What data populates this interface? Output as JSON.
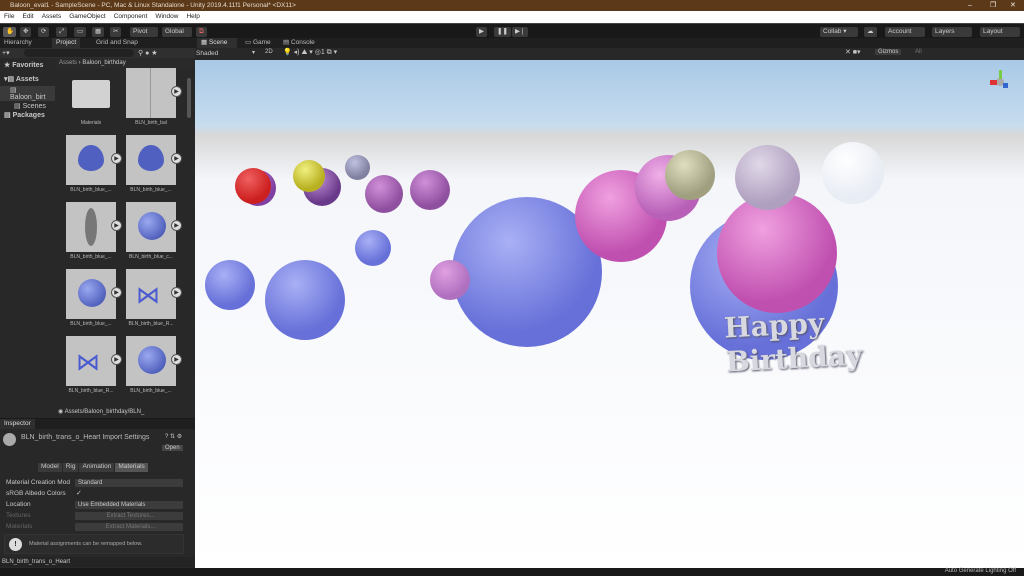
{
  "title": "Baloon_eval1 - SampleScene - PC, Mac & Linux Standalone - Unity 2019.4.11f1 Personal* <DX11>",
  "window_controls": [
    "–",
    "❐",
    "✕"
  ],
  "menu": [
    "File",
    "Edit",
    "Assets",
    "GameObject",
    "Component",
    "Window",
    "Help"
  ],
  "toolbar": {
    "pivot": "Pivot",
    "global": "Global",
    "collab": "Collab ▾",
    "account": "Account",
    "layers": "Layers",
    "layout": "Layout"
  },
  "left_tabs": [
    "Hierarchy",
    "Project",
    "Grid and Snap"
  ],
  "project": {
    "tree": {
      "favorites": "Favorites",
      "assets": "Assets",
      "baloon": "Baloon_birt",
      "scenes": "Scenes",
      "packages": "Packages"
    },
    "breadcrumb": [
      "Assets",
      "Baloon_birthday"
    ],
    "items": [
      "Materials",
      "BLN_birth_bal",
      "BLN_birth_blue_...",
      "BLN_birth_blue_...",
      "BLN_birth_blue_...",
      "BLN_birth_blue_c...",
      "BLN_birth_blue_...",
      "BLN_birth_blue_R...",
      "BLN_birth_blue_R...",
      "BLN_birth_blue_..."
    ],
    "path": "Assets/Baloon_birthday/BLN_"
  },
  "inspector": {
    "tab": "Inspector",
    "title": "BLN_birth_trans_o_Heart Import Settings",
    "open": "Open",
    "subtabs": [
      "Model",
      "Rig",
      "Animation",
      "Materials"
    ],
    "rows": [
      {
        "label": "Material Creation Mod",
        "value": "Standard"
      },
      {
        "label": "sRGB Albedo Colors",
        "value": "✓"
      },
      {
        "label": "Location",
        "value": "Use Embedded Materials"
      },
      {
        "label": "Textures",
        "value": "Extract Textures..."
      },
      {
        "label": "Materials",
        "value": "Extract Materials..."
      }
    ],
    "info": "Material assignments can be remapped below.",
    "footer": "BLN_birth_trans_o_Heart"
  },
  "scene_tabs": [
    "Scene",
    "Game",
    "Console"
  ],
  "scene_toolbar": {
    "shading": "Shaded",
    "mode": "2D",
    "gizmos": "Gizmos",
    "search": "All"
  },
  "scene_text": {
    "line1": "Happy",
    "line2": "Birthday"
  },
  "status": "Auto Generate Lighting Off"
}
